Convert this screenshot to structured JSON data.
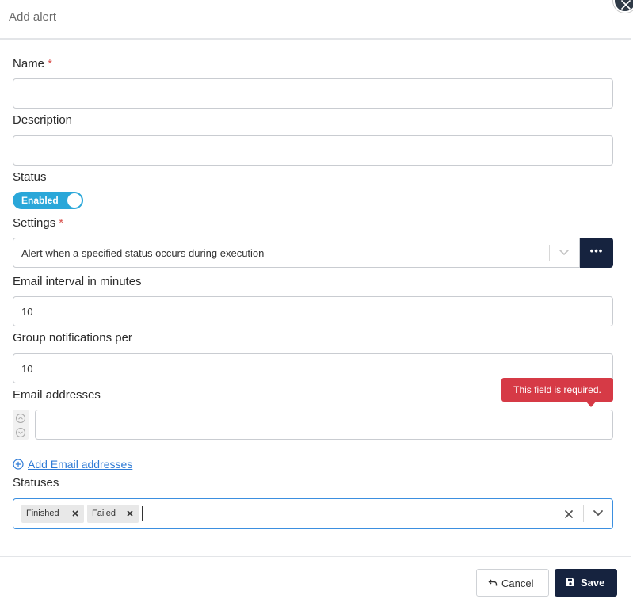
{
  "dialog": {
    "title": "Add alert"
  },
  "form": {
    "name": {
      "label": "Name",
      "required_mark": "*",
      "value": ""
    },
    "description": {
      "label": "Description",
      "value": ""
    },
    "status": {
      "label": "Status",
      "toggle_label": "Enabled",
      "enabled": true
    },
    "settings": {
      "label": "Settings",
      "required_mark": "*",
      "selected": "Alert when a specified status occurs during execution",
      "more_label": "•••"
    },
    "email_interval": {
      "label": "Email interval in minutes",
      "value": "10"
    },
    "group_notifications": {
      "label": "Group notifications per",
      "value": "10"
    },
    "email_addresses": {
      "label": "Email addresses",
      "value": "",
      "error": "This field is required.",
      "add_link": "Add Email addresses"
    },
    "statuses": {
      "label": "Statuses",
      "chips": [
        "Finished",
        "Failed"
      ]
    }
  },
  "footer": {
    "cancel_label": "Cancel",
    "save_label": "Save"
  },
  "colors": {
    "primary": "#16233f",
    "toggle": "#2aa7d9",
    "error": "#d63a46",
    "link": "#2f7bd6",
    "focus": "#3b8fe0",
    "required": "#d9534f"
  },
  "icons": {
    "close": "close-icon",
    "chevron": "chevron-down-icon",
    "more": "more-dots-icon",
    "arrow_up": "arrow-up-circle-icon",
    "arrow_down": "arrow-down-circle-icon",
    "add": "plus-circle-icon",
    "remove_chip": "close-icon",
    "undo": "undo-icon",
    "save": "floppy-disk-icon"
  }
}
